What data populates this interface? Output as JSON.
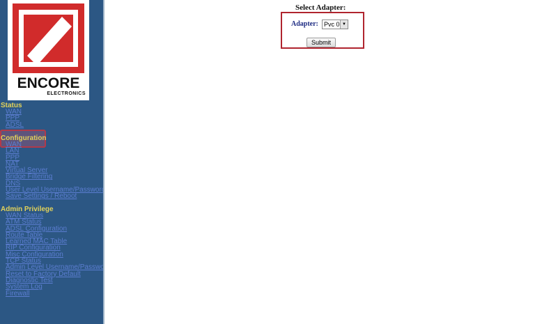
{
  "logo": {
    "brand": "ENCORE",
    "sub": "ELECTRONICS"
  },
  "sidebar": {
    "status": {
      "title": "Status",
      "items": [
        "WAN",
        "PPP",
        "ADSL"
      ]
    },
    "configuration": {
      "title": "Configuration",
      "items": [
        "WAN",
        "LAN",
        "PPP",
        "NAT",
        "Virtual Server",
        "Bridge Filtering",
        "DNS",
        "User Level Username/Password",
        "Save Settings / Reboot"
      ]
    },
    "admin": {
      "title": "Admin Privilege",
      "items": [
        "WAN Status",
        "ATM Status",
        "ADSL Configuration",
        "Route Table",
        "Learned MAC Table",
        "RIP Configuration",
        "Misc Configuration",
        "TCP Status",
        "Admin Level Username/Password",
        "Reset to Factory Default",
        "Diagnostic Test",
        "System Log",
        "Firewall"
      ]
    }
  },
  "main": {
    "title": "Select Adapter:",
    "adapter_label": "Adapter:",
    "adapter_value": "Pvc 0",
    "submit_label": "Submit"
  },
  "colors": {
    "sidebar_bg": "#2c5784",
    "section_title": "#e2d25a",
    "link": "#5b7dd0",
    "form_border": "#b0242e",
    "logo_red": "#d12b2b"
  }
}
